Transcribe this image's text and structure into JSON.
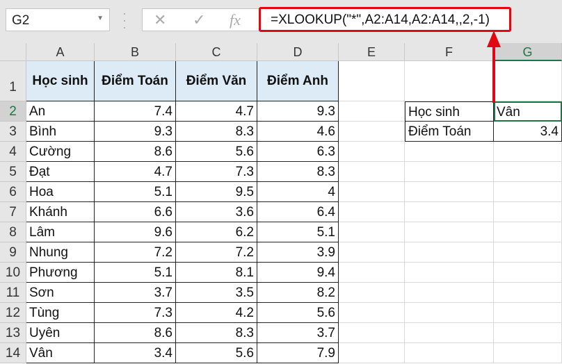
{
  "name_box": "G2",
  "formula_bar": {
    "cancel": "✕",
    "enter": "✓",
    "fx": "fx",
    "formula": "=XLOOKUP(\"*\",A2:A14,A2:A14,,2,-1)"
  },
  "columns": [
    "A",
    "B",
    "C",
    "D",
    "E",
    "F",
    "G"
  ],
  "headers": [
    "Học sinh",
    "Điểm Toán",
    "Điểm Văn",
    "Điểm Anh"
  ],
  "rows": [
    [
      "An",
      "7.4",
      "4.7",
      "9.3"
    ],
    [
      "Bình",
      "9.3",
      "8.3",
      "4.6"
    ],
    [
      "Cường",
      "8.6",
      "5.6",
      "6.3"
    ],
    [
      "Đạt",
      "4.7",
      "7.3",
      "8.3"
    ],
    [
      "Hoa",
      "5.1",
      "9.5",
      "4"
    ],
    [
      "Khánh",
      "6.6",
      "3.6",
      "6.4"
    ],
    [
      "Lâm",
      "9.6",
      "6.2",
      "5.1"
    ],
    [
      "Nhung",
      "7.2",
      "7.2",
      "3.9"
    ],
    [
      "Phương",
      "5.1",
      "8.1",
      "9.4"
    ],
    [
      "Sơn",
      "3.7",
      "3.5",
      "8.2"
    ],
    [
      "Tùng",
      "7.3",
      "4.2",
      "5.6"
    ],
    [
      "Uyên",
      "8.6",
      "8.3",
      "3.7"
    ],
    [
      "Vân",
      "3.4",
      "5.6",
      "7.9"
    ]
  ],
  "lookup": {
    "label1": "Học sinh",
    "value1": "Vân",
    "label2": "Điểm Toán",
    "value2": "3.4"
  },
  "colors": {
    "accent": "#e30613",
    "selection": "#217346",
    "header_fill": "#ddebf7"
  }
}
